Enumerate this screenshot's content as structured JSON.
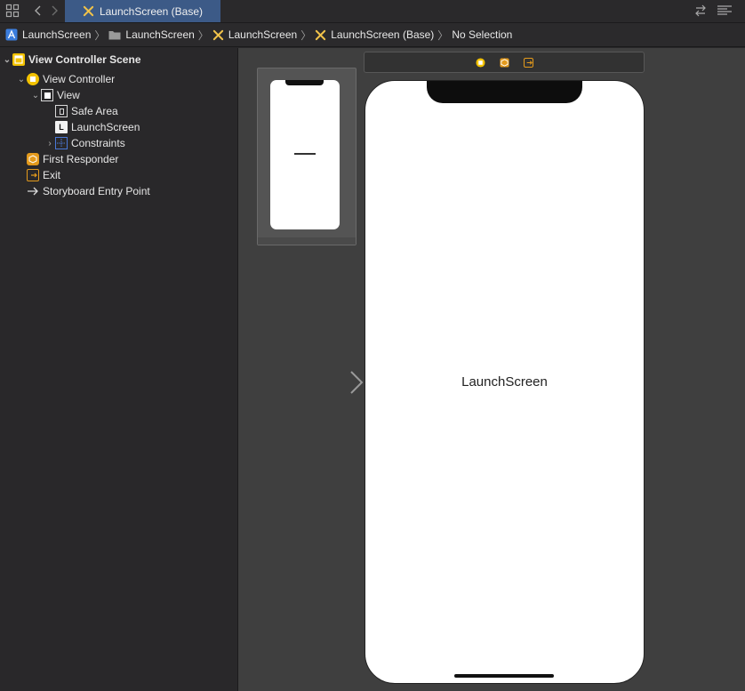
{
  "tabbar": {
    "active_tab": "LaunchScreen (Base)"
  },
  "breadcrumb": {
    "items": [
      "LaunchScreen",
      "LaunchScreen",
      "LaunchScreen",
      "LaunchScreen (Base)",
      "No Selection"
    ]
  },
  "outline": {
    "scene": "View Controller Scene",
    "view_controller": "View Controller",
    "view": "View",
    "safe_area": "Safe Area",
    "label": "LaunchScreen",
    "constraints": "Constraints",
    "first_responder": "First Responder",
    "exit": "Exit",
    "entry_point": "Storyboard Entry Point"
  },
  "canvas": {
    "phone_label": "LaunchScreen"
  },
  "colors": {
    "accent_tab": "#3c5a87",
    "scene_icon": "#f2c200",
    "responder_icon": "#e39a1c"
  }
}
